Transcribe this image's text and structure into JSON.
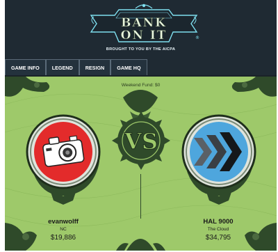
{
  "header": {
    "logo_line1": "BANK",
    "logo_line2": "ON IT",
    "registered": "®",
    "subtitle": "BROUGHT TO YOU BY THE AICPA"
  },
  "tabs": [
    {
      "label": "GAME INFO"
    },
    {
      "label": "LEGEND"
    },
    {
      "label": "RESIGN"
    },
    {
      "label": "GAME HQ"
    }
  ],
  "board": {
    "fund_label": "Weekend Fund: $0",
    "vs_text": "VS"
  },
  "players": [
    {
      "name": "evanwolff",
      "location": "NC",
      "money": "$19,886",
      "icon": "camera-icon",
      "badge_color": "#e32b2b"
    },
    {
      "name": "HAL 9000",
      "location": "The Cloud",
      "money": "$34,795",
      "icon": "chevrons-icon",
      "badge_color": "#4ea6dd"
    }
  ],
  "colors": {
    "background_dark": "#1f2a33",
    "board_green": "#9ec96a",
    "ornament_dark": "#2f4a2a",
    "logo_cyan": "#7fe0f0"
  }
}
